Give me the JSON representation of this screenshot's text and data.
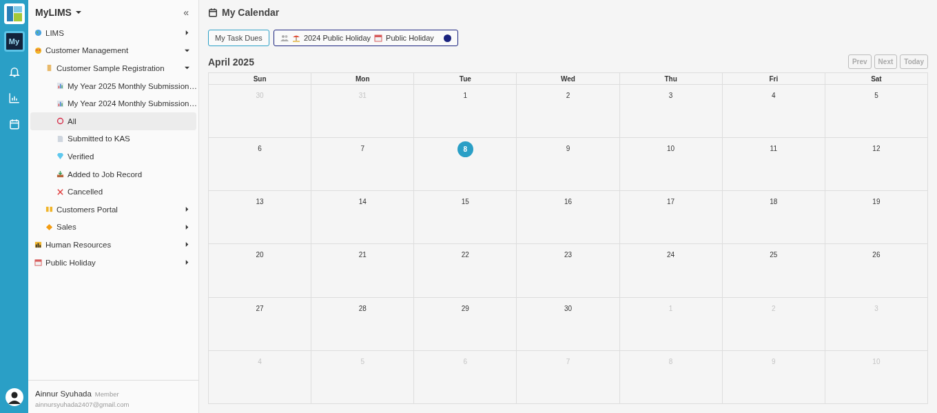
{
  "app": {
    "title": "MyLIMS",
    "rail_badge": "My",
    "collapse": "«"
  },
  "menu": [
    {
      "label": "LIMS",
      "expanded": false
    },
    {
      "label": "Customer Management",
      "expanded": true,
      "children": [
        {
          "label": "Customer Sample Registration",
          "expanded": true,
          "children": [
            {
              "label": "My Year 2025 Monthly Submission…",
              "selected": false
            },
            {
              "label": "My Year 2024 Monthly Submission…",
              "selected": false
            },
            {
              "label": "All",
              "selected": true
            },
            {
              "label": "Submitted to KAS",
              "selected": false
            },
            {
              "label": "Verified",
              "selected": false
            },
            {
              "label": "Added to Job Record",
              "selected": false
            },
            {
              "label": "Cancelled",
              "selected": false
            }
          ]
        },
        {
          "label": "Customers Portal",
          "expanded": false
        },
        {
          "label": "Sales",
          "expanded": false
        }
      ]
    },
    {
      "label": "Human Resources",
      "expanded": false
    },
    {
      "label": "Public Holiday",
      "expanded": false
    }
  ],
  "user": {
    "name": "Ainnur Syuhada",
    "role": "Member",
    "email": "ainnursyuhada2407@gmail.com"
  },
  "page_title": "My Calendar",
  "filters": {
    "task_button": "My Task Dues",
    "legend": [
      {
        "label": "2024 Public Holiday"
      },
      {
        "label": "Public Holiday"
      }
    ],
    "color": "#1a237e"
  },
  "month": "April 2025",
  "nav_buttons": [
    {
      "label": "Prev",
      "disabled": true
    },
    {
      "label": "Next",
      "disabled": true
    },
    {
      "label": "Today",
      "disabled": true
    }
  ],
  "weekdays": [
    "Sun",
    "Mon",
    "Tue",
    "Wed",
    "Thu",
    "Fri",
    "Sat"
  ],
  "weeks": [
    [
      {
        "day": "30",
        "other": true,
        "today": false
      },
      {
        "day": "31",
        "other": true,
        "today": false
      },
      {
        "day": "1",
        "other": false,
        "today": false
      },
      {
        "day": "2",
        "other": false,
        "today": false
      },
      {
        "day": "3",
        "other": false,
        "today": false
      },
      {
        "day": "4",
        "other": false,
        "today": false
      },
      {
        "day": "5",
        "other": false,
        "today": false
      }
    ],
    [
      {
        "day": "6",
        "other": false,
        "today": false
      },
      {
        "day": "7",
        "other": false,
        "today": false
      },
      {
        "day": "8",
        "other": false,
        "today": true
      },
      {
        "day": "9",
        "other": false,
        "today": false
      },
      {
        "day": "10",
        "other": false,
        "today": false
      },
      {
        "day": "11",
        "other": false,
        "today": false
      },
      {
        "day": "12",
        "other": false,
        "today": false
      }
    ],
    [
      {
        "day": "13",
        "other": false,
        "today": false
      },
      {
        "day": "14",
        "other": false,
        "today": false
      },
      {
        "day": "15",
        "other": false,
        "today": false
      },
      {
        "day": "16",
        "other": false,
        "today": false
      },
      {
        "day": "17",
        "other": false,
        "today": false
      },
      {
        "day": "18",
        "other": false,
        "today": false
      },
      {
        "day": "19",
        "other": false,
        "today": false
      }
    ],
    [
      {
        "day": "20",
        "other": false,
        "today": false
      },
      {
        "day": "21",
        "other": false,
        "today": false
      },
      {
        "day": "22",
        "other": false,
        "today": false
      },
      {
        "day": "23",
        "other": false,
        "today": false
      },
      {
        "day": "24",
        "other": false,
        "today": false
      },
      {
        "day": "25",
        "other": false,
        "today": false
      },
      {
        "day": "26",
        "other": false,
        "today": false
      }
    ],
    [
      {
        "day": "27",
        "other": false,
        "today": false
      },
      {
        "day": "28",
        "other": false,
        "today": false
      },
      {
        "day": "29",
        "other": false,
        "today": false
      },
      {
        "day": "30",
        "other": false,
        "today": false
      },
      {
        "day": "1",
        "other": true,
        "today": false
      },
      {
        "day": "2",
        "other": true,
        "today": false
      },
      {
        "day": "3",
        "other": true,
        "today": false
      }
    ],
    [
      {
        "day": "4",
        "other": true,
        "today": false
      },
      {
        "day": "5",
        "other": true,
        "today": false
      },
      {
        "day": "6",
        "other": true,
        "today": false
      },
      {
        "day": "7",
        "other": true,
        "today": false
      },
      {
        "day": "8",
        "other": true,
        "today": false
      },
      {
        "day": "9",
        "other": true,
        "today": false
      },
      {
        "day": "10",
        "other": true,
        "today": false
      }
    ]
  ]
}
